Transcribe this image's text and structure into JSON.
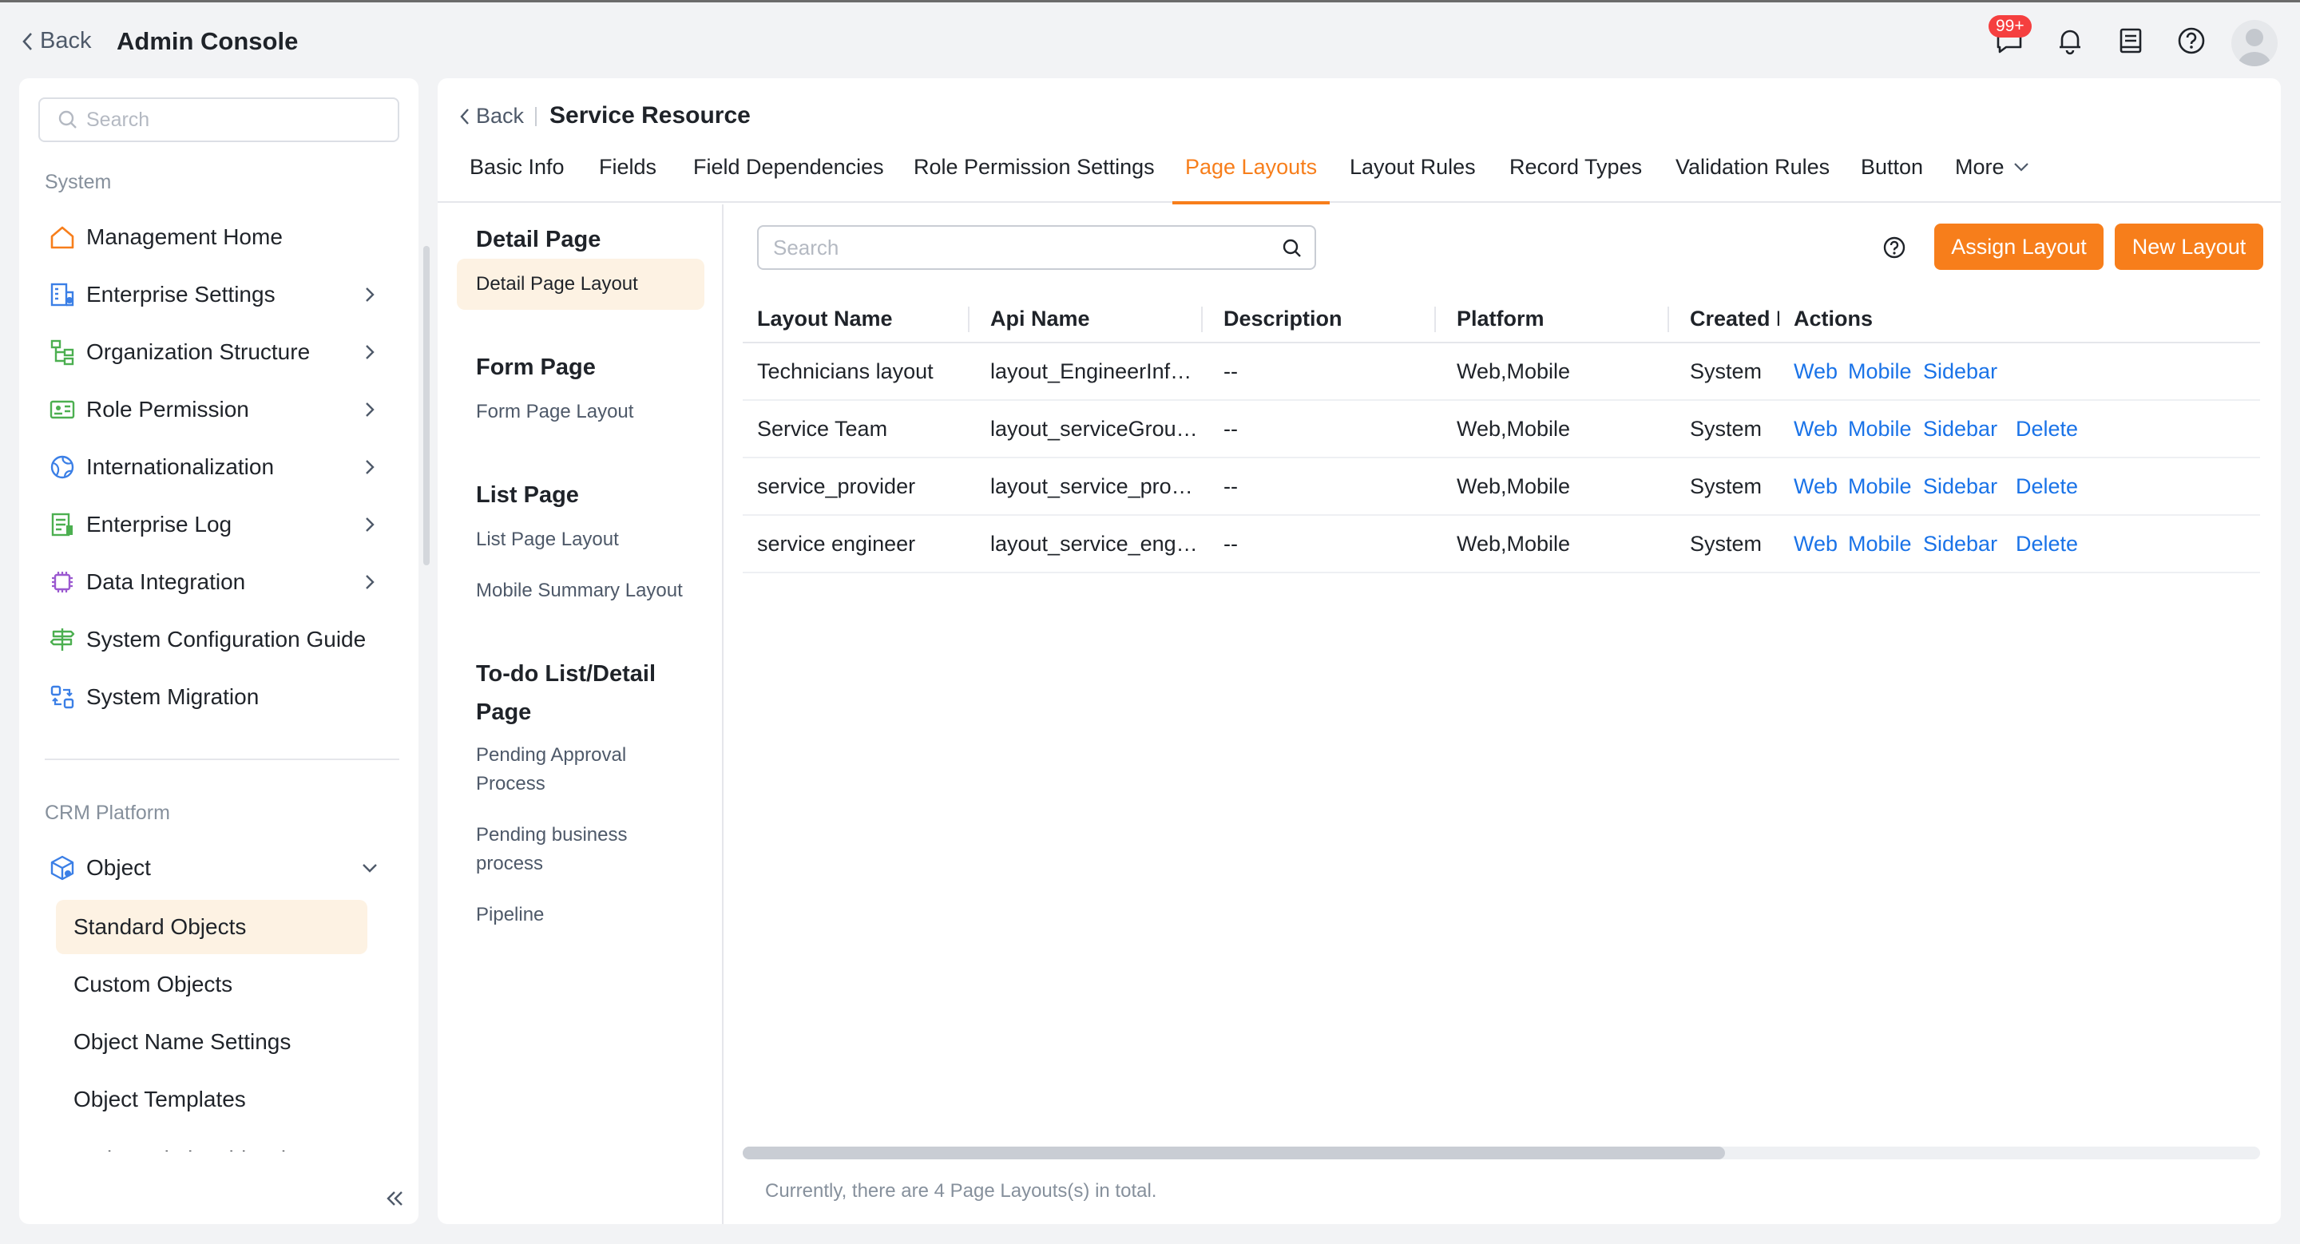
{
  "header": {
    "back_label": "Back",
    "title": "Admin Console",
    "badge": "99+",
    "icons": [
      "chat-icon",
      "bell-icon",
      "notebook-icon",
      "help-icon",
      "avatar"
    ]
  },
  "sidebar": {
    "search_placeholder": "Search",
    "system_label": "System",
    "items": [
      {
        "label": "Management Home",
        "icon": "home-icon",
        "chevron": false
      },
      {
        "label": "Enterprise Settings",
        "icon": "building-icon",
        "chevron": true
      },
      {
        "label": "Organization Structure",
        "icon": "org-icon",
        "chevron": true
      },
      {
        "label": "Role Permission",
        "icon": "id-card-icon",
        "chevron": true
      },
      {
        "label": "Internationalization",
        "icon": "globe-icon",
        "chevron": true
      },
      {
        "label": "Enterprise Log",
        "icon": "log-icon",
        "chevron": true
      },
      {
        "label": "Data Integration",
        "icon": "chip-icon",
        "chevron": true
      },
      {
        "label": "System Configuration Guide",
        "icon": "signpost-icon",
        "chevron": false
      },
      {
        "label": "System Migration",
        "icon": "migration-icon",
        "chevron": false
      }
    ],
    "crm_label": "CRM Platform",
    "object_label": "Object",
    "sub_items": [
      "Standard Objects",
      "Custom Objects",
      "Object Name Settings",
      "Object Templates",
      "Entity Relationship Diagram"
    ]
  },
  "main": {
    "back_label": "Back",
    "title": "Service Resource",
    "tabs": [
      "Basic Info",
      "Fields",
      "Field Dependencies",
      "Role Permission Settings",
      "Page Layouts",
      "Layout Rules",
      "Record Types",
      "Validation Rules",
      "Button",
      "More"
    ],
    "active_tab": "Page Layouts",
    "left_nav": {
      "detail_heading": "Detail Page",
      "detail_item": "Detail Page Layout",
      "form_heading": "Form Page",
      "form_item": "Form Page Layout",
      "list_heading": "List Page",
      "list_item": "List Page Layout",
      "mobile_item": "Mobile Summary Layout",
      "todo_heading_1": "To-do List/Detail",
      "todo_heading_2": "Page",
      "pending_approval_1": "Pending Approval",
      "pending_approval_2": "Process",
      "pending_business_1": "Pending business",
      "pending_business_2": "process",
      "pipeline": "Pipeline"
    },
    "search_placeholder": "Search",
    "assign_label": "Assign Layout",
    "new_label": "New Layout",
    "columns": [
      "Layout Name",
      "Api Name",
      "Description",
      "Platform",
      "Created By",
      "Actions"
    ],
    "rows": [
      {
        "name": "Technicians layout",
        "api": "layout_EngineerInf…",
        "desc": "--",
        "platform": "Web,Mobile",
        "created": "System",
        "actions": [
          "Web",
          "Mobile",
          "Sidebar"
        ]
      },
      {
        "name": "Service Team",
        "api": "layout_serviceGrou…",
        "desc": "--",
        "platform": "Web,Mobile",
        "created": "System",
        "actions": [
          "Web",
          "Mobile",
          "Sidebar",
          "Delete"
        ]
      },
      {
        "name": "service_provider",
        "api": "layout_service_pro…",
        "desc": "--",
        "platform": "Web,Mobile",
        "created": "System",
        "actions": [
          "Web",
          "Mobile",
          "Sidebar",
          "Delete"
        ]
      },
      {
        "name": "service engineer",
        "api": "layout_service_engi…",
        "desc": "--",
        "platform": "Web,Mobile",
        "created": "System",
        "actions": [
          "Web",
          "Mobile",
          "Sidebar",
          "Delete"
        ]
      }
    ],
    "footer": "Currently, there are 4 Page Layouts(s) in total."
  },
  "colors": {
    "accent": "#f77e1b",
    "link": "#1a73e8",
    "active_bg": "#fdf2e3"
  }
}
